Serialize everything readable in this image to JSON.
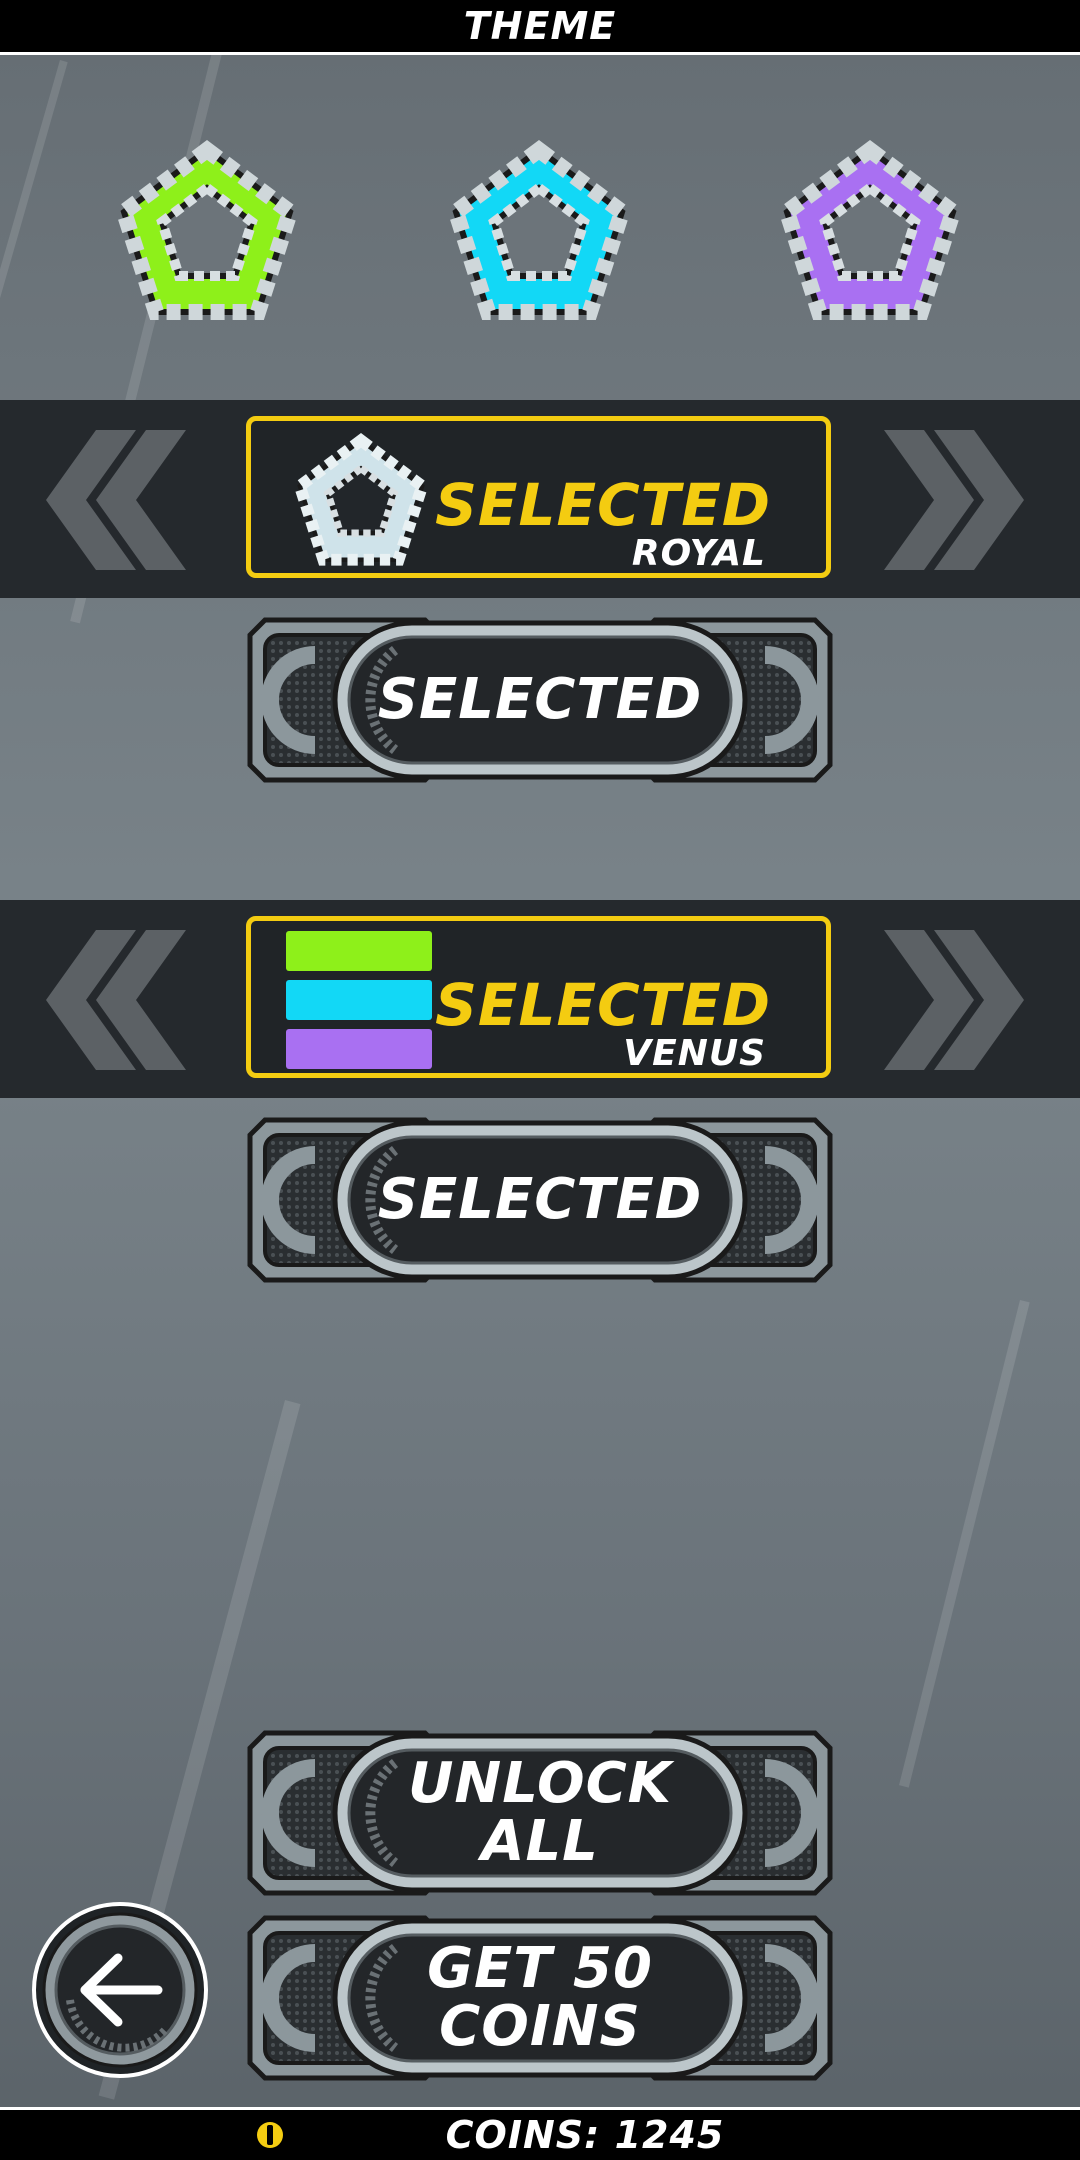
{
  "header": {
    "title": "THEME"
  },
  "previews": [
    {
      "color": "#8ef01a",
      "name": "green-pentagon-icon"
    },
    {
      "color": "#12d8f6",
      "name": "cyan-pentagon-icon"
    },
    {
      "color": "#a970f2",
      "name": "purple-pentagon-icon"
    }
  ],
  "skin_selector": {
    "status": "SELECTED",
    "name": "ROYAL",
    "button_label": "SELECTED"
  },
  "color_selector": {
    "status": "SELECTED",
    "name": "VENUS",
    "swatches": [
      "#8ef01a",
      "#12d8f6",
      "#a970f2"
    ],
    "button_label": "SELECTED"
  },
  "actions": {
    "unlock_all_label": "UNLOCK ALL",
    "get_coins_label": "GET 50 COINS"
  },
  "footer": {
    "coins_text": "COINS: 1245"
  },
  "colors": {
    "accent": "#f4cc11",
    "band": "#25292d"
  }
}
